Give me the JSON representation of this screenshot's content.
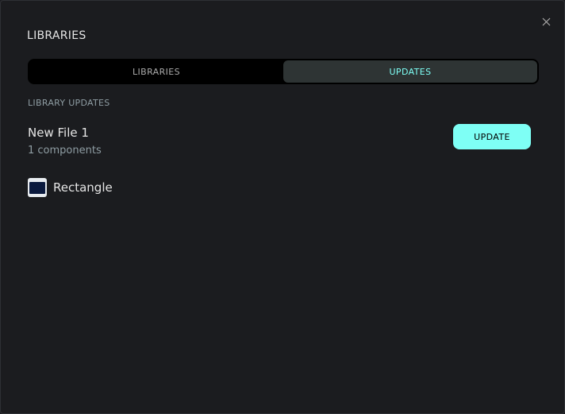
{
  "modal": {
    "title": "LIBRARIES",
    "close_icon": "close-icon"
  },
  "tabs": [
    {
      "label": "LIBRARIES",
      "active": false
    },
    {
      "label": "UPDATES",
      "active": true
    }
  ],
  "section": {
    "label": "LIBRARY UPDATES"
  },
  "library": {
    "name": "New File 1",
    "count": "1 components",
    "update_label": "UPDATE"
  },
  "components": [
    {
      "name": "Rectangle",
      "icon": "rectangle-thumbnail"
    }
  ],
  "colors": {
    "accent": "#7efff5",
    "background": "#1b1c1f",
    "tab_active_bg": "#2e3434",
    "muted_text": "#8f9da3"
  }
}
